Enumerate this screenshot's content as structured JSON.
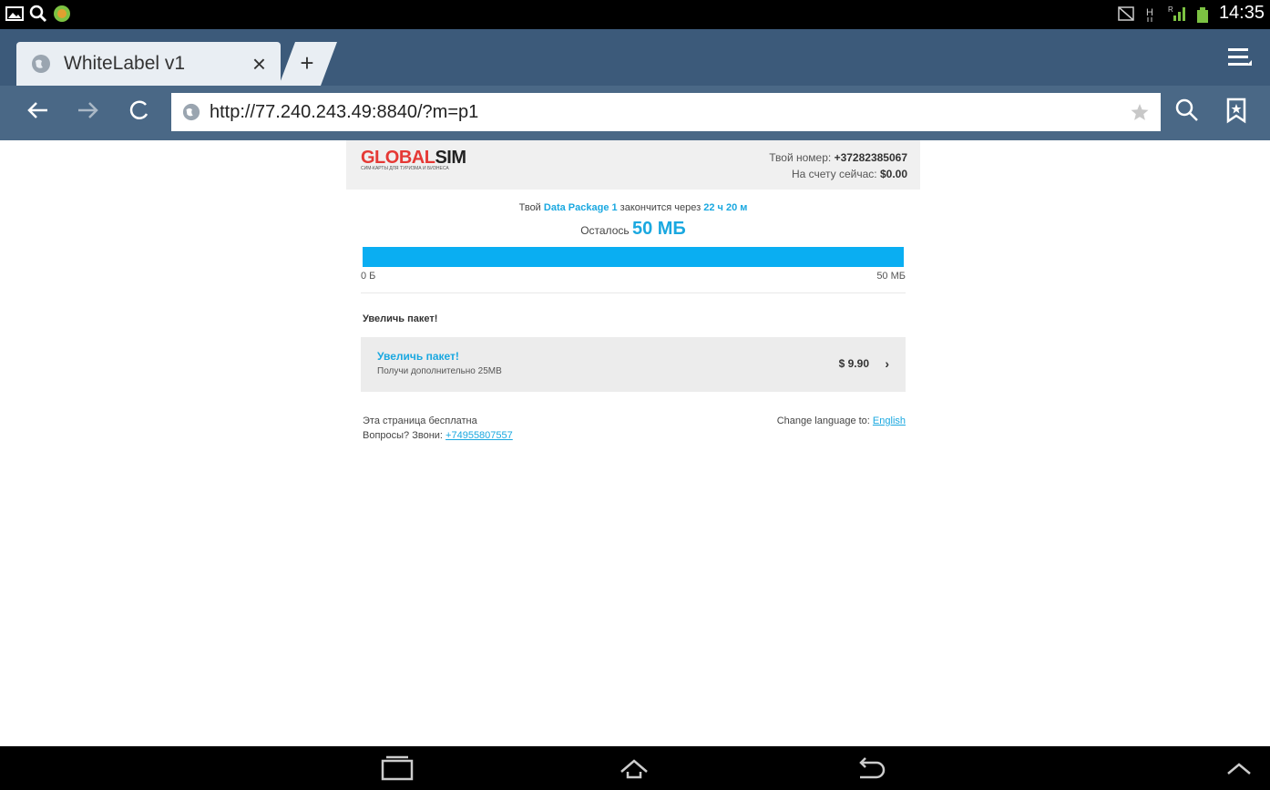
{
  "status_bar": {
    "time": "14:35"
  },
  "tab": {
    "title": "WhiteLabel v1",
    "close_symbol": "×",
    "new_tab_symbol": "+"
  },
  "toolbar": {
    "url": "http://77.240.243.49:8840/?m=p1"
  },
  "header": {
    "logo": {
      "part1": "GLOBAL",
      "part2": "SIM",
      "tagline": "СИМ-КАРТЫ ДЛЯ ТУРИЗМА И БИЗНЕСА"
    },
    "number_label": "Твой номер:",
    "number_value": "+37282385067",
    "balance_label": "На счету сейчас:",
    "balance_value": "$0.00"
  },
  "package": {
    "prefix": "Твой",
    "name": "Data Package 1",
    "middle": "закончится через",
    "time_left": "22 ч 20 м",
    "remaining_label": "Осталось",
    "remaining_value": "50 МБ",
    "fill_fraction": 1.0,
    "scale_min": "0 Б",
    "scale_max": "50 МБ"
  },
  "upgrade": {
    "section_title": "Увеличь пакет!",
    "offer_name": "Увеличь пакет!",
    "offer_desc": "Получи дополнительно 25МВ",
    "offer_price": "$ 9.90",
    "offer_chevron": "›"
  },
  "footer": {
    "free_text": "Эта страница бесплатна",
    "questions_label": "Вопросы? Звони:",
    "phone": "+74955807557",
    "language_label": "Change language to:",
    "language_link": "English"
  },
  "colors": {
    "accent": "#1aa8e0",
    "bar_fill": "#0aaef2",
    "tab_strip": "#3c5a7a",
    "toolbar": "#4a6886"
  }
}
